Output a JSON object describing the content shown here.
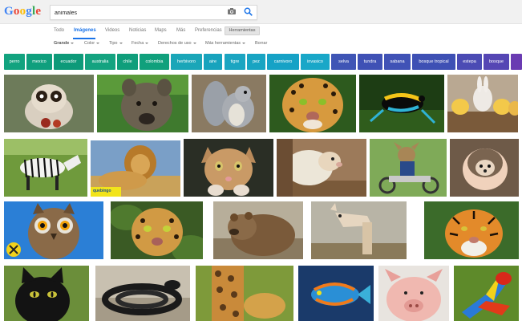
{
  "header": {
    "logo_letters": [
      "G",
      "o",
      "o",
      "g",
      "l",
      "e"
    ],
    "logo_colors": [
      "#4285f4",
      "#ea4335",
      "#fbbc05",
      "#4285f4",
      "#34a853",
      "#ea4335"
    ],
    "search": {
      "value": "animales",
      "camera_icon": "camera-icon",
      "search_icon": "magnifier-icon"
    }
  },
  "tabs": {
    "items": [
      "Todo",
      "Imágenes",
      "Videos",
      "Noticias",
      "Maps",
      "Más",
      "Preferencias"
    ],
    "active": "Imágenes",
    "tools_label": "Herramientas"
  },
  "filters": {
    "items": [
      "Grande",
      "Color",
      "Tipo",
      "Fecha",
      "Derechos de uso",
      "Más herramientas"
    ],
    "clear_label": "Borrar"
  },
  "chips": [
    {
      "label": "perro",
      "color": "#12a37f"
    },
    {
      "label": "mexico",
      "color": "#0f9f7d"
    },
    {
      "label": "ecuador",
      "color": "#0d9a79"
    },
    {
      "label": "australia",
      "color": "#14a380"
    },
    {
      "label": "chile",
      "color": "#0f9e7b"
    },
    {
      "label": "colombia",
      "color": "#10a07c"
    },
    {
      "label": "herbivoro",
      "color": "#1aa6b8"
    },
    {
      "label": "aire",
      "color": "#17a3bd"
    },
    {
      "label": "tigre",
      "color": "#1ba5c1"
    },
    {
      "label": "pez",
      "color": "#18a4c2"
    },
    {
      "label": "carnivoro",
      "color": "#16a2c6"
    },
    {
      "label": "invasico",
      "color": "#19a7c8"
    },
    {
      "label": "selva",
      "color": "#3f55b5"
    },
    {
      "label": "tundra",
      "color": "#3f51b5"
    },
    {
      "label": "sabana",
      "color": "#4052b6"
    },
    {
      "label": "bosque tropical",
      "color": "#3e50b4"
    },
    {
      "label": "estepa",
      "color": "#4b4bb4"
    },
    {
      "label": "bosque",
      "color": "#5546b4"
    },
    {
      "label": "",
      "color": "#6a3bb2"
    }
  ],
  "images": [
    {
      "name": "loris",
      "bg": "#6d7b5a"
    },
    {
      "name": "hyena",
      "bg": "#3f7a2e"
    },
    {
      "name": "squirrel",
      "bg": "#8a7a62"
    },
    {
      "name": "jaguar-face",
      "bg": "#c78b3c"
    },
    {
      "name": "frog",
      "bg": "#1d3d14"
    },
    {
      "name": "chicks",
      "bg": "#b9a892"
    },
    {
      "name": "zebra",
      "bg": "#6f9a3c"
    },
    {
      "name": "lion",
      "bg": "#7a9fc7",
      "badge": "quebingo"
    },
    {
      "name": "kitten",
      "bg": "#2a2e25"
    },
    {
      "name": "sheep",
      "bg": "#9c7a5a"
    },
    {
      "name": "dog-motorbike",
      "bg": "#7faa58"
    },
    {
      "name": "hedgehog",
      "bg": "#6e5a48"
    },
    {
      "name": "owl",
      "bg": "#2b7fd6"
    },
    {
      "name": "jaguar-leaves",
      "bg": "#3a5a24"
    },
    {
      "name": "bear",
      "bg": "#8a6c4b"
    },
    {
      "name": "llama",
      "bg": "#b8b4a6"
    },
    {
      "name": "tiger",
      "bg": "#3b6b2a"
    },
    {
      "name": "black-cat",
      "bg": "#6b8e3a"
    },
    {
      "name": "snake",
      "bg": "#c8c0b0"
    },
    {
      "name": "giraffe-cheetah",
      "bg": "#7e9a3a"
    },
    {
      "name": "mandarin-fish",
      "bg": "#1a3a6a"
    },
    {
      "name": "pig",
      "bg": "#e8e4df"
    },
    {
      "name": "macaw",
      "bg": "#5e8a2a"
    }
  ]
}
